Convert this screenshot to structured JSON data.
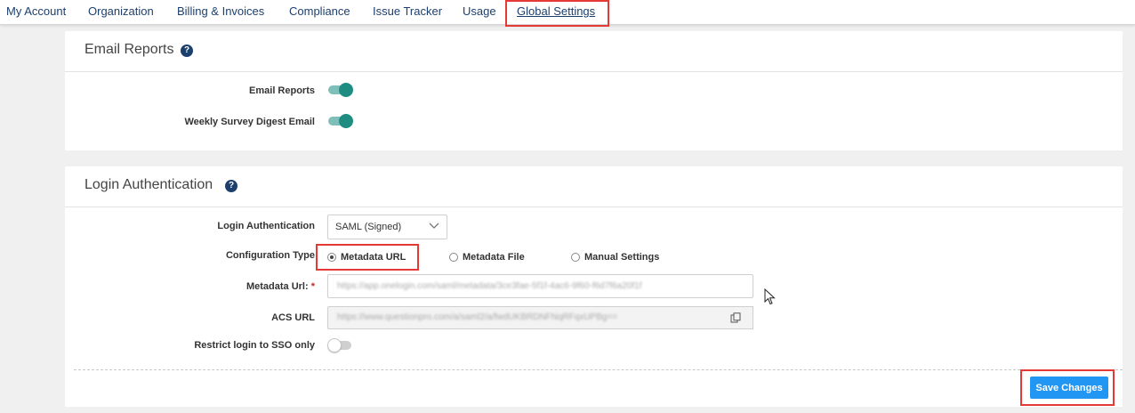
{
  "nav": {
    "tabs": [
      {
        "label": "My Account"
      },
      {
        "label": "Organization"
      },
      {
        "label": "Billing & Invoices"
      },
      {
        "label": "Compliance"
      },
      {
        "label": "Issue Tracker"
      },
      {
        "label": "Usage"
      },
      {
        "label": "Global Settings",
        "active": true
      }
    ]
  },
  "email_reports": {
    "title": "Email Reports",
    "help_icon": "question-circle-icon",
    "email_reports_label": "Email Reports",
    "email_reports_enabled": true,
    "weekly_digest_label": "Weekly Survey Digest Email",
    "weekly_digest_enabled": true
  },
  "login_auth": {
    "title": "Login Authentication",
    "help_icon": "question-circle-icon",
    "login_auth_label": "Login Authentication",
    "login_auth_value": "SAML (Signed)",
    "config_type_label": "Configuration Type",
    "config_options": [
      "Metadata URL",
      "Metadata File",
      "Manual Settings"
    ],
    "config_selected": "Metadata URL",
    "metadata_url_label": "Metadata Url:",
    "metadata_url_required_mark": "*",
    "metadata_url_value": "https://app.onelogin.com/saml/metadata/3ce3fae-5f1f-4ac6-9f60-f6d7f6a20f1f",
    "acs_url_label": "ACS URL",
    "acs_url_value": "https://www.questionpro.com/a/saml2/a/fwdUKBRDNFNqRFqxUPBg==",
    "copy_icon": "copy-icon",
    "restrict_sso_label": "Restrict login to SSO only",
    "restrict_sso_enabled": false,
    "save_label": "Save Changes"
  },
  "colors": {
    "nav_text": "#1c3f6e",
    "toggle_on": "#1e8c81",
    "save_button": "#2196f3",
    "highlight": "#e53935"
  }
}
